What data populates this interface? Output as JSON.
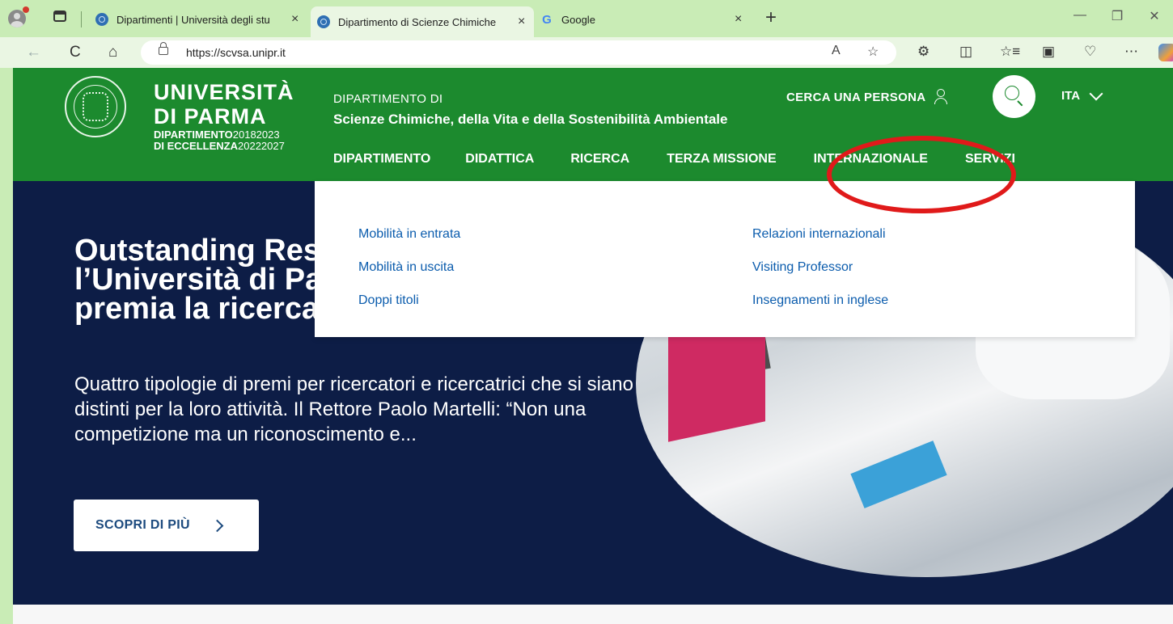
{
  "browser": {
    "tabs": [
      {
        "title": "Dipartimenti | Università degli stu",
        "active": false
      },
      {
        "title": "Dipartimento di Scienze Chimiche",
        "active": true
      },
      {
        "title": "Google",
        "active": false
      }
    ],
    "url": "https://scvsa.unipr.it",
    "icons": {
      "close": "×",
      "new_tab": "+",
      "back": "←",
      "refresh": "C",
      "home": "⌂",
      "read_aloud": "A",
      "favorite": "☆",
      "extensions": "⚙",
      "split": "◫",
      "favorites": "☆≡",
      "collections": "▣",
      "health": "♡",
      "more": "⋯",
      "minimize": "—",
      "restore": "❐",
      "window_close": "✕",
      "google": "G"
    }
  },
  "header": {
    "brand_line1": "UNIVERSITÀ",
    "brand_line2": "DI PARMA",
    "brand_line3": "DIPARTIMENTO",
    "brand_line3_years": "20182023",
    "brand_line4": "DI ECCELLENZA",
    "brand_line4_years": "20222027",
    "dept_kicker": "DIPARTIMENTO DI",
    "dept_name": "Scienze Chimiche, della Vita e della Sostenibilità Ambientale",
    "search_person": "CERCA UNA PERSONA",
    "language": "ITA"
  },
  "nav": {
    "items": [
      "DIPARTIMENTO",
      "DIDATTICA",
      "RICERCA",
      "TERZA MISSIONE",
      "INTERNAZIONALE",
      "SERVIZI"
    ]
  },
  "dropdown": {
    "left": [
      "Mobilità in entrata",
      "Mobilità in uscita",
      "Doppi titoli"
    ],
    "right": [
      "Relazioni internazionali",
      "Visiting Professor",
      "Insegnamenti in inglese"
    ]
  },
  "hero": {
    "title": "Outstanding Researcher: l’Università di Parma premia la ricerca",
    "text": "Quattro tipologie di premi per ricercatori e ricercatrici che si siano distinti per la loro attività. Il Rettore Paolo Martelli: “Non una competizione ma un riconoscimento e...",
    "cta": "SCOPRI DI PIÙ"
  },
  "colors": {
    "brand_green": "#1c8a2e",
    "hero_navy": "#0d1d46",
    "link_blue": "#0b5cad",
    "highlight_red": "#e01a1a"
  }
}
